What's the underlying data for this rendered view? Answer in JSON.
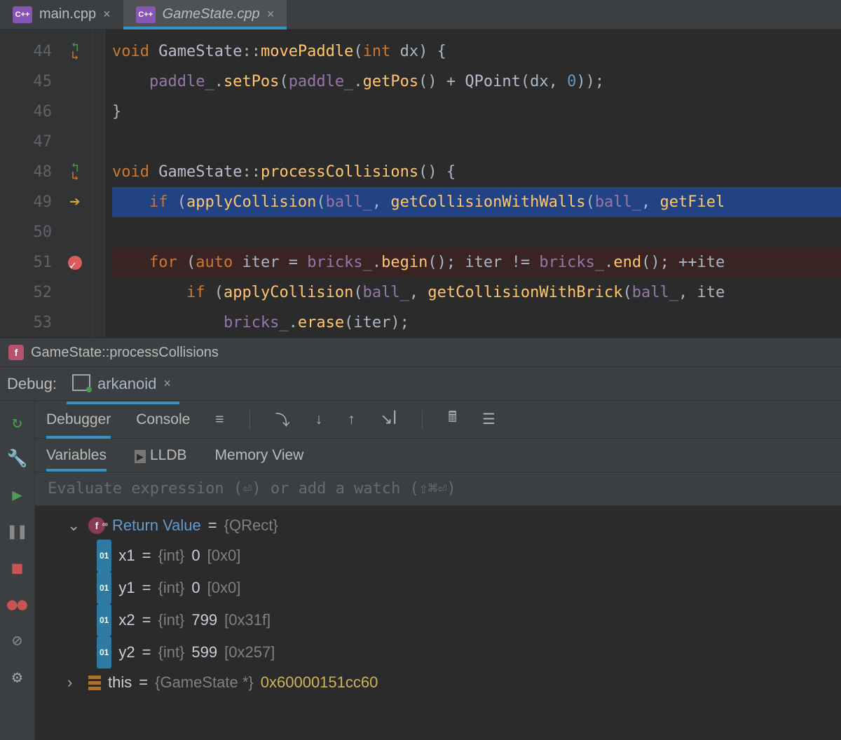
{
  "tabs": [
    {
      "label": "main.cpp",
      "active": false
    },
    {
      "label": "GameState.cpp",
      "active": true
    }
  ],
  "code": {
    "l44": {
      "num": "44"
    },
    "l45": {
      "num": "45"
    },
    "l46": {
      "num": "46"
    },
    "l47": {
      "num": "47"
    },
    "l48": {
      "num": "48"
    },
    "l49": {
      "num": "49"
    },
    "l50": {
      "num": "50"
    },
    "l51": {
      "num": "51"
    },
    "l52": {
      "num": "52"
    },
    "l53": {
      "num": "53"
    }
  },
  "line44": {
    "kw1": "void",
    "cls": "GameState",
    "sep": "::",
    "fn": "movePaddle",
    "p": "(",
    "kw2": "int",
    "sp": " dx) {"
  },
  "line45_raw": "    paddle_.setPos(paddle_.getPos() + QPoint(dx, 0));",
  "line46_raw": "}",
  "line48": {
    "kw1": "void",
    "cls": "GameState",
    "sep": "::",
    "fn": "processCollisions",
    "rest": "() {"
  },
  "line49": {
    "kw": "if",
    "call": "applyCollision",
    "f1": "ball_",
    "fn2": "getCollisionWithWalls",
    "f2": "ball_",
    "fn3": "getFiel"
  },
  "line51": {
    "kw": "for",
    "kw2": "auto",
    "var": "iter",
    "f1": "bricks_",
    "fn1": "begin",
    "f2": "bricks_",
    "fn2": "end",
    "inc": "++ite"
  },
  "line52": {
    "kw": "if",
    "call": "applyCollision",
    "f1": "ball_",
    "fn2": "getCollisionWithBrick",
    "f2": "ball_",
    "rest": "ite"
  },
  "line53": {
    "f": "bricks_",
    "fn": "erase",
    "arg": "iter"
  },
  "breadcrumb": "GameState::processCollisions",
  "debug_section": {
    "label": "Debug:",
    "app": "arkanoid"
  },
  "panel_tabs": {
    "t1": "Debugger",
    "t2": "Console"
  },
  "sub_tabs": {
    "t1": "Variables",
    "t2": "LLDB",
    "t3": "Memory View"
  },
  "eval_placeholder": "Evaluate expression (⏎) or add a watch (⇧⌘⏎)",
  "vars": {
    "ret": {
      "name": "Return Value",
      "eq": " = ",
      "type": "{QRect}"
    },
    "x1": {
      "name": "x1",
      "eq": " = ",
      "type": "{int}",
      "val": " 0 ",
      "hex": "[0x0]"
    },
    "y1": {
      "name": "y1",
      "eq": " = ",
      "type": "{int}",
      "val": " 0 ",
      "hex": "[0x0]"
    },
    "x2": {
      "name": "x2",
      "eq": " = ",
      "type": "{int}",
      "val": " 799 ",
      "hex": "[0x31f]"
    },
    "y2": {
      "name": "y2",
      "eq": " = ",
      "type": "{int}",
      "val": " 599 ",
      "hex": "[0x257]"
    },
    "this": {
      "name": "this",
      "eq": " = ",
      "type": "{GameState *}",
      "val": " 0x60000151cc60"
    }
  }
}
